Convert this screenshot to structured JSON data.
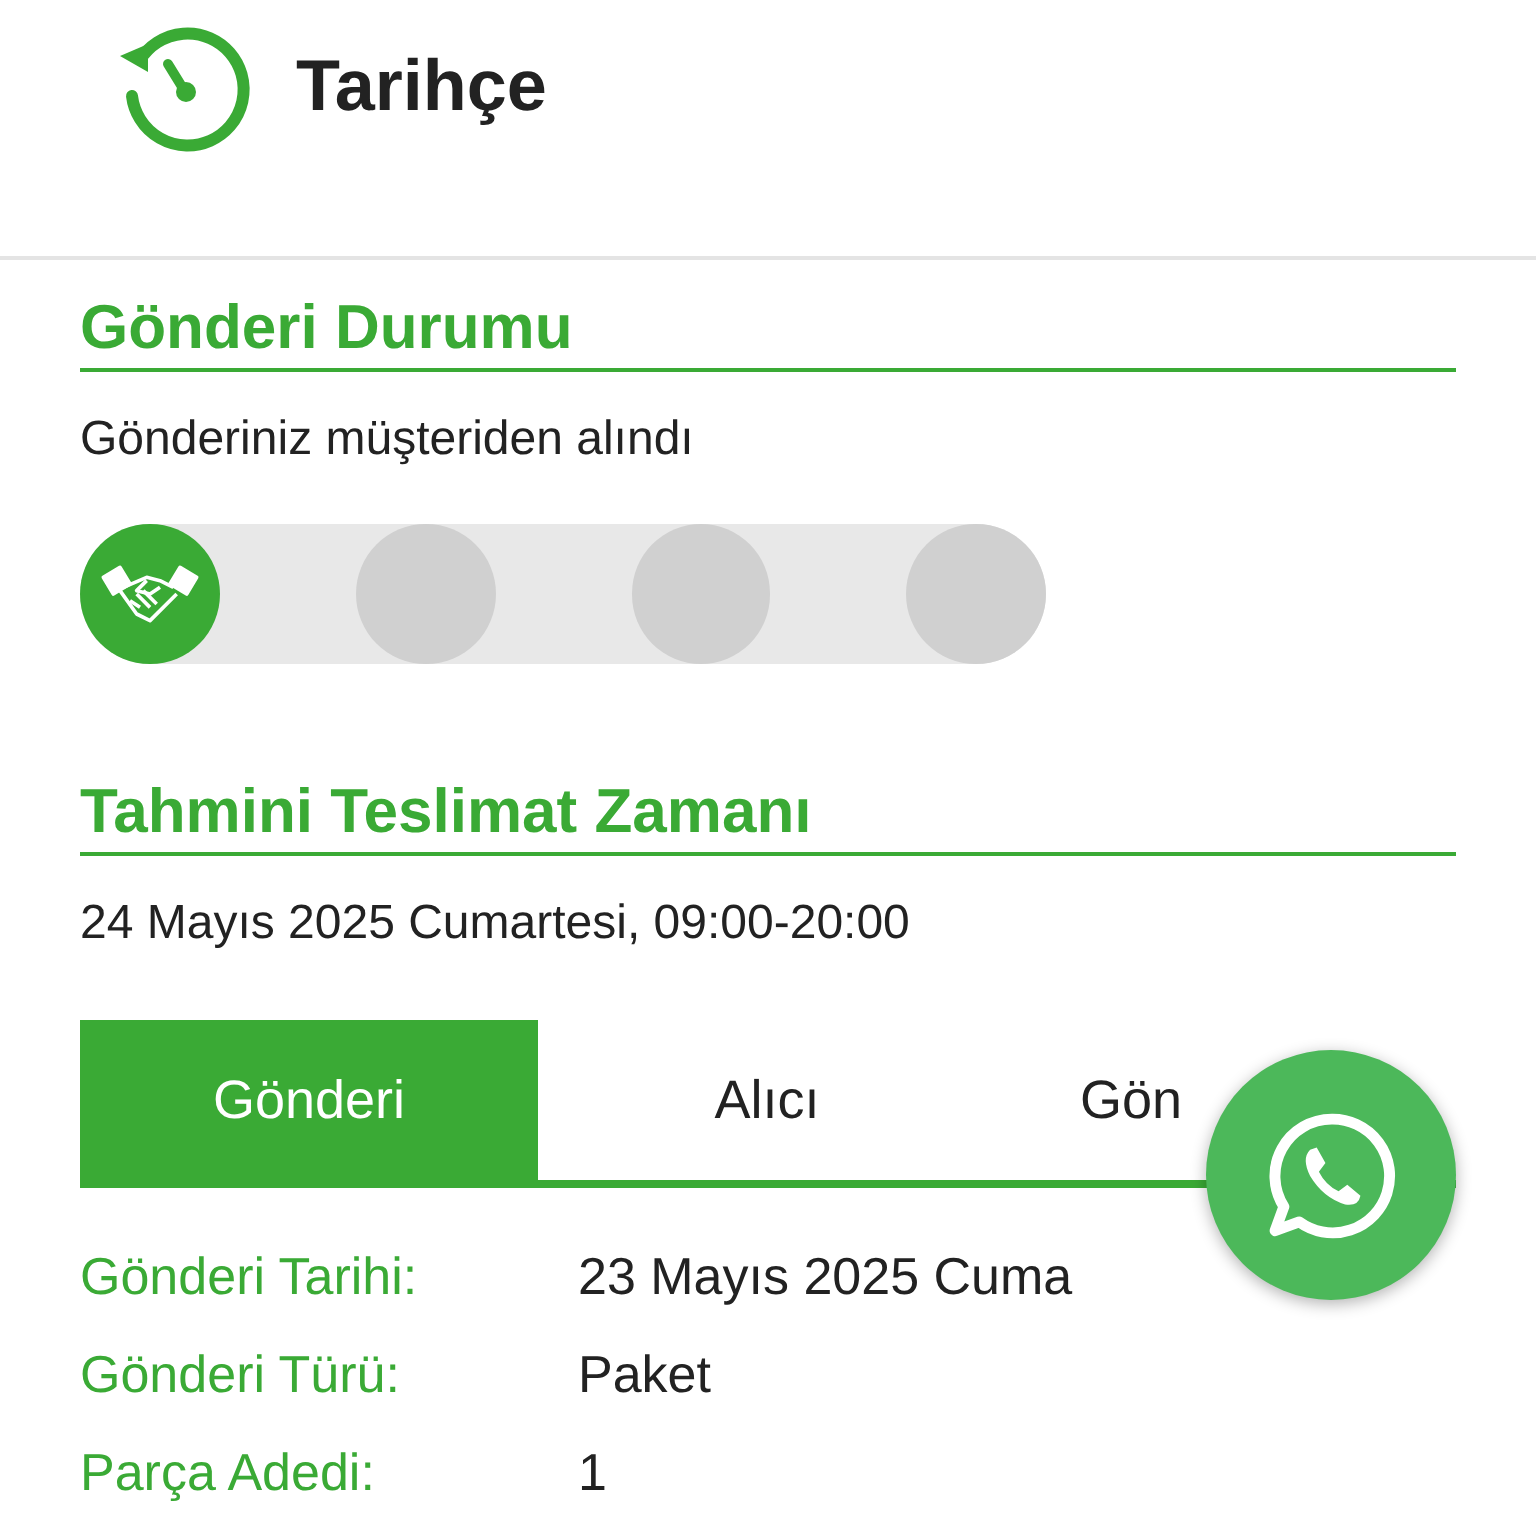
{
  "header": {
    "title": "Tarihçe"
  },
  "status": {
    "title": "Gönderi Durumu",
    "message": "Gönderiniz müşteriden alındı",
    "steps": [
      {
        "done": true
      },
      {
        "done": false
      },
      {
        "done": false
      },
      {
        "done": false
      }
    ]
  },
  "estimate": {
    "title": "Tahmini Teslimat Zamanı",
    "value": "24 Mayıs 2025 Cumartesi, 09:00-20:00"
  },
  "tabs": [
    {
      "label": "Gönderi",
      "selected": true
    },
    {
      "label": "Alıcı",
      "selected": false
    },
    {
      "label": "Gön",
      "selected": false
    }
  ],
  "details": [
    {
      "label": "Gönderi Tarihi:",
      "value": "23 Mayıs 2025 Cuma"
    },
    {
      "label": "Gönderi Türü:",
      "value": "Paket"
    },
    {
      "label": "Parça Adedi:",
      "value": "1"
    }
  ]
}
